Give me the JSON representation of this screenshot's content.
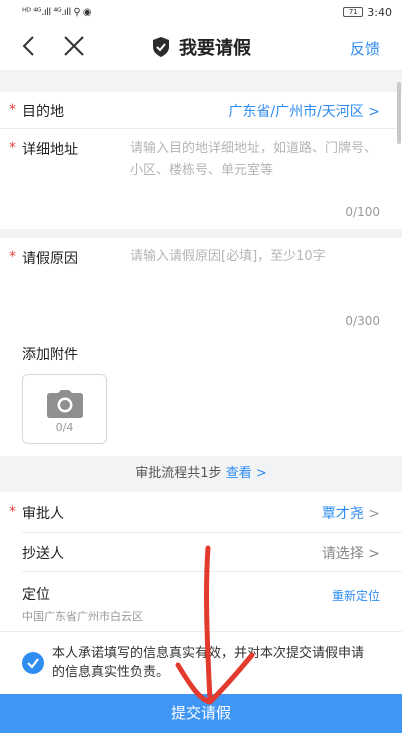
{
  "status_bar": {
    "left_glyphs": "ᴴᴰ ⁴ᴳ.ıll ⁴ᴳ.ıll ⚲ ◉",
    "time": "3:40",
    "battery": "71"
  },
  "nav": {
    "title": "我要请假",
    "feedback": "反馈"
  },
  "form": {
    "destination": {
      "label": "目的地",
      "value": "广东省/广州市/天河区",
      "chevron": ">"
    },
    "address": {
      "label": "详细地址",
      "placeholder": "请输入目的地详细地址，如道路、门牌号、小区、楼栋号、单元室等",
      "counter": "0/100"
    },
    "reason": {
      "label": "请假原因",
      "placeholder": "请输入请假原因[必填]，至少10字",
      "counter": "0/300"
    },
    "attachment": {
      "label": "添加附件",
      "count": "0/4"
    },
    "flow": {
      "text": "审批流程共1步",
      "link": "查看 >"
    },
    "approver": {
      "label": "审批人",
      "value": "覃才尧",
      "chevron": ">"
    },
    "cc": {
      "label": "抄送人",
      "value": "请选择",
      "chevron": ">"
    },
    "location": {
      "label": "定位",
      "sub": "中国广东省广州市白云区",
      "action": "重新定位"
    }
  },
  "consent": {
    "text": "本人承诺填写的信息真实有效，并对本次提交请假申请的信息真实性负责。"
  },
  "submit": {
    "label": "提交请假"
  },
  "colors": {
    "accent": "#2f8cf0",
    "required": "#e64340",
    "annotation": "#e23b2e"
  }
}
